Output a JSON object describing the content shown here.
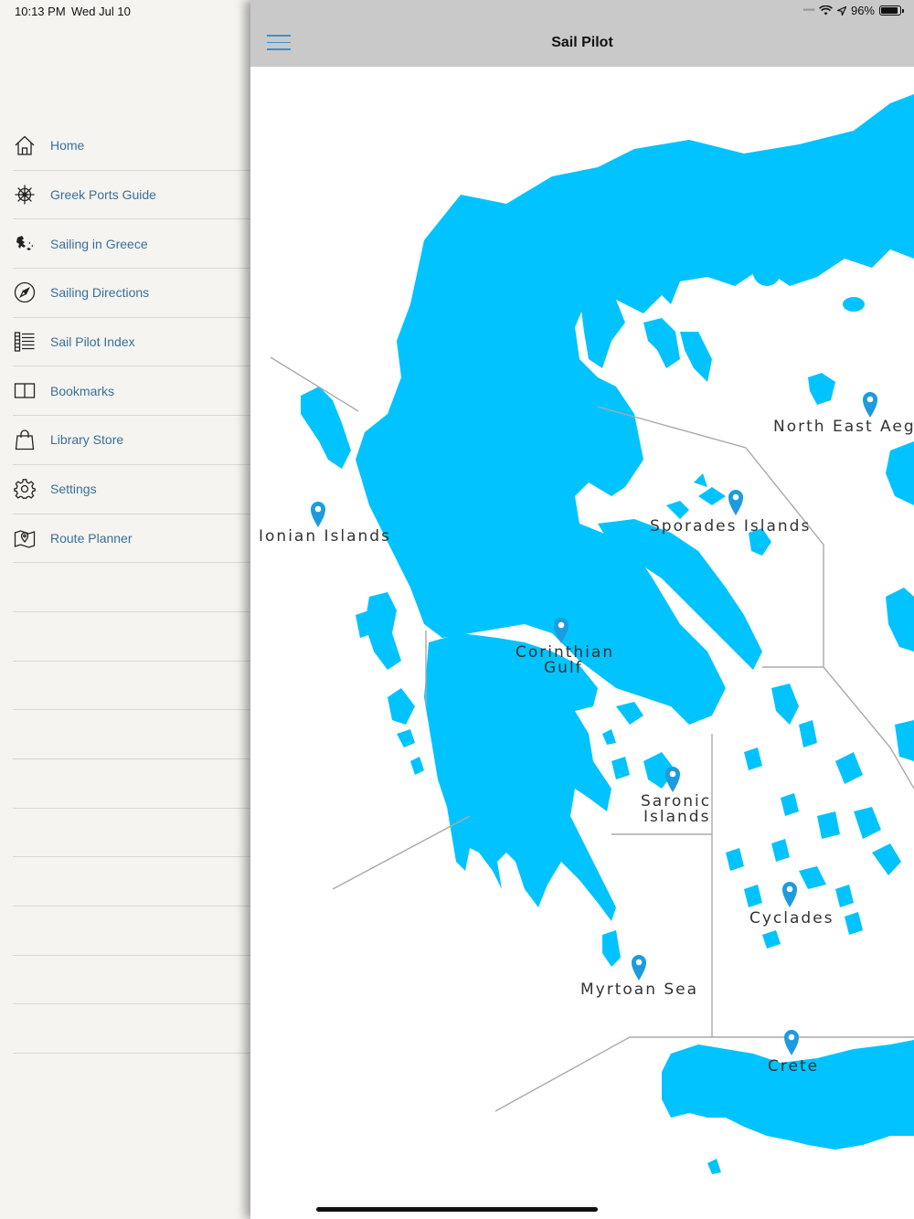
{
  "status": {
    "time": "10:13 PM",
    "date": "Wed Jul 10",
    "battery": "96%"
  },
  "app": {
    "title": "Sail Pilot"
  },
  "menu": [
    {
      "label": "Home",
      "icon": "home-icon"
    },
    {
      "label": "Greek Ports Guide",
      "icon": "ship-wheel-icon"
    },
    {
      "label": "Sailing in Greece",
      "icon": "greece-map-icon"
    },
    {
      "label": "Sailing Directions",
      "icon": "compass-icon"
    },
    {
      "label": "Sail Pilot Index",
      "icon": "index-list-icon"
    },
    {
      "label": "Bookmarks",
      "icon": "book-icon"
    },
    {
      "label": "Library Store",
      "icon": "shopping-bag-icon"
    },
    {
      "label": "Settings",
      "icon": "gear-icon"
    },
    {
      "label": "Route Planner",
      "icon": "map-pin-icon"
    }
  ],
  "map": {
    "regions": [
      {
        "name": "Ionian Islands"
      },
      {
        "name": "North East Aegean"
      },
      {
        "name": "Sporades Islands"
      },
      {
        "name": "Corinthian",
        "name2": "Gulf"
      },
      {
        "name": "Saronic",
        "name2": "Islands"
      },
      {
        "name": "Cyclades"
      },
      {
        "name": "Myrtoan Sea"
      },
      {
        "name": "Crete"
      }
    ],
    "land_color": "#00c3ff",
    "pin_color": "#1d9be0"
  }
}
